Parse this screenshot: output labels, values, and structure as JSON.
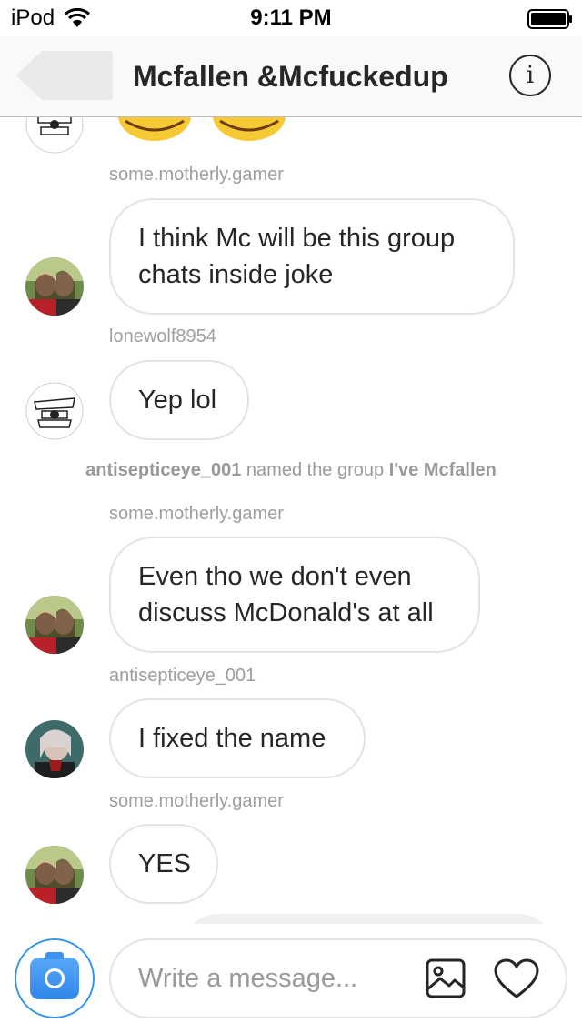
{
  "status_bar": {
    "carrier": "iPod",
    "time": "9:11 PM"
  },
  "header": {
    "title": "Mcfallen &Mcfuckedup",
    "info_label": "i"
  },
  "messages": [
    {
      "username": "some.motherly.gamer",
      "text": "I think Mc will be this group chats inside joke"
    },
    {
      "username": "lonewolf8954",
      "text": "Yep lol"
    },
    {
      "username": "some.motherly.gamer",
      "text": "Even tho we don't even discuss McDonald's at all"
    },
    {
      "username": "antisepticeye_001",
      "text": "I fixed the name"
    },
    {
      "username": "some.motherly.gamer",
      "text": "YES"
    }
  ],
  "system_event": {
    "actor": "antisepticeye_001",
    "action": "named the group",
    "group_name": "I've Mcfallen"
  },
  "composer": {
    "placeholder": "Write a message..."
  },
  "icons": {
    "wifi": "wifi-icon",
    "battery": "battery-icon",
    "back": "back-arrow-icon",
    "info": "info-icon",
    "camera": "camera-icon",
    "gallery": "gallery-icon",
    "like": "heart-icon"
  },
  "colors": {
    "accent": "#3897f0",
    "bubble_border": "#e3e3e3",
    "username": "#9e9e9e"
  }
}
